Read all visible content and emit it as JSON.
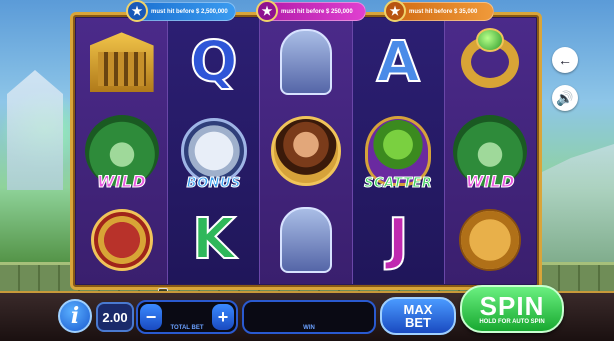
{
  "jackpots": [
    {
      "text": "must hit before $ 2,500,000",
      "color": "#1a6fd0"
    },
    {
      "text": "must hit before $ 250,000",
      "color": "#b01aa8"
    },
    {
      "text": "must hit before $ 35,000",
      "color": "#d06a12"
    }
  ],
  "reels": [
    [
      "temple-icon",
      "medusa-wild-icon",
      "shield-sword-icon"
    ],
    [
      "letter-q-icon",
      "pegasus-bonus-icon",
      "letter-k-icon"
    ],
    [
      "warrior-icon",
      "hero-icon",
      "warrior-icon"
    ],
    [
      "letter-a-icon",
      "snake-scatter-icon",
      "letter-j-icon"
    ],
    [
      "ring-icon",
      "medusa-wild-icon",
      "gold-coin-icon"
    ]
  ],
  "symbols": {
    "q": "Q",
    "a": "A",
    "k": "K",
    "j": "J",
    "wild": "WILD",
    "bonus": "BONUS",
    "scatter": "SCATTER"
  },
  "controls": {
    "info_label": "i",
    "bet_value": "2.00",
    "minus_label": "−",
    "plus_label": "+",
    "total_bet_label": "TOTAL BET",
    "win_label": "WIN",
    "maxbet_line1": "MAX",
    "maxbet_line2": "BET",
    "spin_label": "SPIN",
    "spin_sub": "HOLD FOR AUTO SPIN",
    "back_label": "←",
    "sound_label": "🔊"
  }
}
